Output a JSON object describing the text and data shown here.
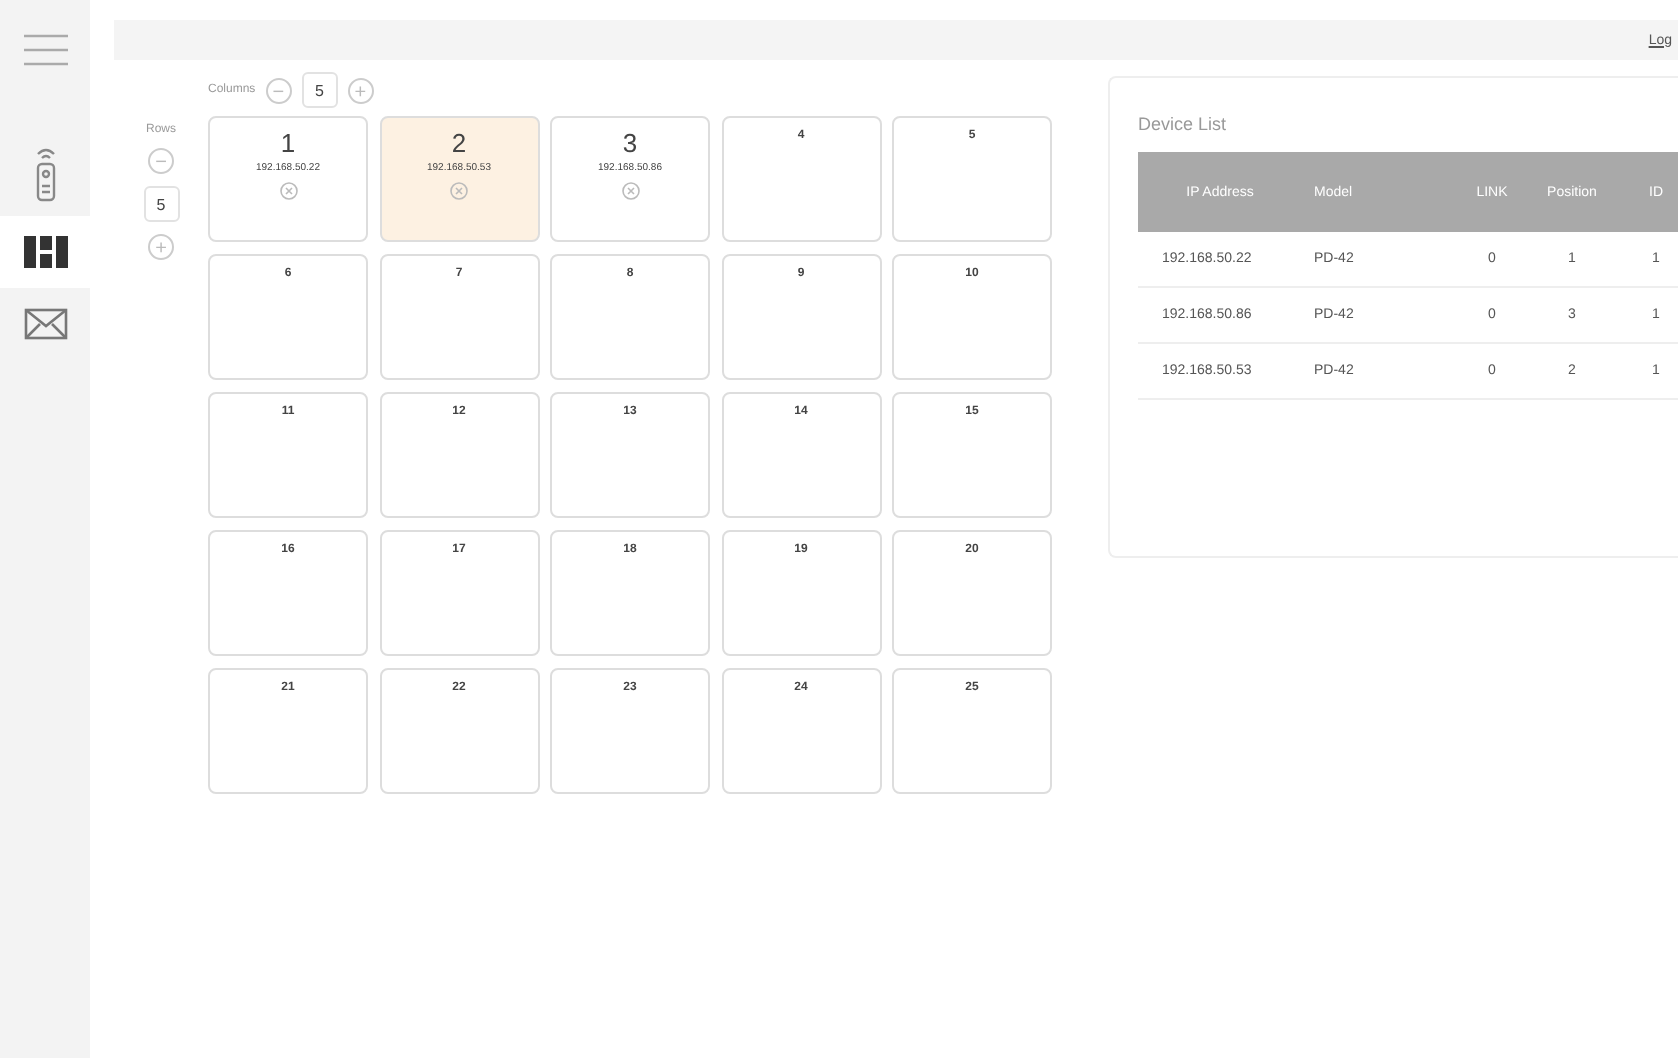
{
  "sidebar": {
    "items": [
      {
        "kind": "menu",
        "selected": false
      },
      {
        "kind": "remote",
        "selected": false
      },
      {
        "kind": "grid",
        "selected": true
      },
      {
        "kind": "mail",
        "selected": false
      }
    ]
  },
  "top_bar": {
    "link": "Log"
  },
  "columns_control": {
    "label": "Columns",
    "value": "5",
    "minus": "−",
    "plus": "+"
  },
  "rows_control": {
    "label": "Rows",
    "value": "5",
    "minus": "−",
    "plus": "+"
  },
  "grid": {
    "cells": [
      {
        "number": "1",
        "ip": "192.168.50.22",
        "selected": false
      },
      {
        "number": "2",
        "ip": "192.168.50.53",
        "selected": true
      },
      {
        "number": "3",
        "ip": "192.168.50.86",
        "selected": false
      },
      {
        "number": "4",
        "selected": false
      },
      {
        "number": "5",
        "selected": false
      },
      {
        "number": "6",
        "selected": false
      },
      {
        "number": "7",
        "selected": false
      },
      {
        "number": "8",
        "selected": false
      },
      {
        "number": "9",
        "selected": false
      },
      {
        "number": "10",
        "selected": false
      },
      {
        "number": "11",
        "selected": false
      },
      {
        "number": "12",
        "selected": false
      },
      {
        "number": "13",
        "selected": false
      },
      {
        "number": "14",
        "selected": false
      },
      {
        "number": "15",
        "selected": false
      },
      {
        "number": "16",
        "selected": false
      },
      {
        "number": "17",
        "selected": false
      },
      {
        "number": "18",
        "selected": false
      },
      {
        "number": "19",
        "selected": false
      },
      {
        "number": "20",
        "selected": false
      },
      {
        "number": "21",
        "selected": false
      },
      {
        "number": "22",
        "selected": false
      },
      {
        "number": "23",
        "selected": false
      },
      {
        "number": "24",
        "selected": false
      },
      {
        "number": "25",
        "selected": false
      }
    ]
  },
  "device_list": {
    "title": "Device List",
    "columns": [
      "IP Address",
      "Model",
      "LINK",
      "Position",
      "ID"
    ],
    "rows": [
      [
        "192.168.50.22",
        "PD-42",
        "0",
        "1",
        "1"
      ],
      [
        "192.168.50.86",
        "PD-42",
        "0",
        "3",
        "1"
      ],
      [
        "192.168.50.53",
        "PD-42",
        "0",
        "2",
        "1"
      ]
    ]
  }
}
